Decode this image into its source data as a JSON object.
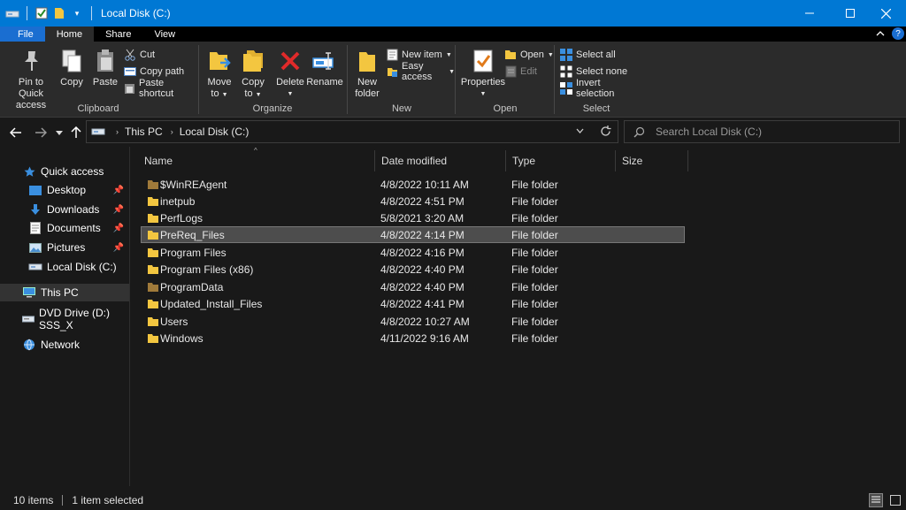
{
  "window": {
    "title": "Local Disk (C:)",
    "accent": "#0078d4"
  },
  "menu": {
    "file": "File",
    "home": "Home",
    "share": "Share",
    "view": "View"
  },
  "ribbon": {
    "clipboard": {
      "label": "Clipboard",
      "pin_line1": "Pin to Quick",
      "pin_line2": "access",
      "copy": "Copy",
      "paste": "Paste",
      "cut": "Cut",
      "copy_path": "Copy path",
      "paste_shortcut": "Paste shortcut"
    },
    "organize": {
      "label": "Organize",
      "move_line1": "Move",
      "move_line2": "to",
      "copy_line1": "Copy",
      "copy_line2": "to",
      "delete": "Delete",
      "rename": "Rename"
    },
    "new": {
      "label": "New",
      "new_folder_line1": "New",
      "new_folder_line2": "folder",
      "new_item": "New item",
      "easy_access": "Easy access"
    },
    "open": {
      "label": "Open",
      "properties": "Properties",
      "open": "Open",
      "edit": "Edit"
    },
    "select": {
      "label": "Select",
      "select_all": "Select all",
      "select_none": "Select none",
      "invert": "Invert selection"
    }
  },
  "address": {
    "this_pc": "This PC",
    "local_disk": "Local Disk (C:)"
  },
  "search": {
    "placeholder": "Search Local Disk (C:)"
  },
  "nav_pane": {
    "quick_access": "Quick access",
    "desktop": "Desktop",
    "downloads": "Downloads",
    "documents": "Documents",
    "pictures": "Pictures",
    "local_disk": "Local Disk (C:)",
    "this_pc": "This PC",
    "dvd": "DVD Drive (D:) SSS_X",
    "network": "Network"
  },
  "columns": {
    "name": "Name",
    "date": "Date modified",
    "type": "Type",
    "size": "Size"
  },
  "files": [
    {
      "name": "$WinREAgent",
      "date": "4/8/2022 10:11 AM",
      "type": "File folder"
    },
    {
      "name": "inetpub",
      "date": "4/8/2022 4:51 PM",
      "type": "File folder"
    },
    {
      "name": "PerfLogs",
      "date": "5/8/2021 3:20 AM",
      "type": "File folder"
    },
    {
      "name": "PreReq_Files",
      "date": "4/8/2022 4:14 PM",
      "type": "File folder"
    },
    {
      "name": "Program Files",
      "date": "4/8/2022 4:16 PM",
      "type": "File folder"
    },
    {
      "name": "Program Files (x86)",
      "date": "4/8/2022 4:40 PM",
      "type": "File folder"
    },
    {
      "name": "ProgramData",
      "date": "4/8/2022 4:40 PM",
      "type": "File folder"
    },
    {
      "name": "Updated_Install_Files",
      "date": "4/8/2022 4:41 PM",
      "type": "File folder"
    },
    {
      "name": "Users",
      "date": "4/8/2022 10:27 AM",
      "type": "File folder"
    },
    {
      "name": "Windows",
      "date": "4/11/2022 9:16 AM",
      "type": "File folder"
    }
  ],
  "status": {
    "items": "10 items",
    "selected": "1 item selected"
  }
}
